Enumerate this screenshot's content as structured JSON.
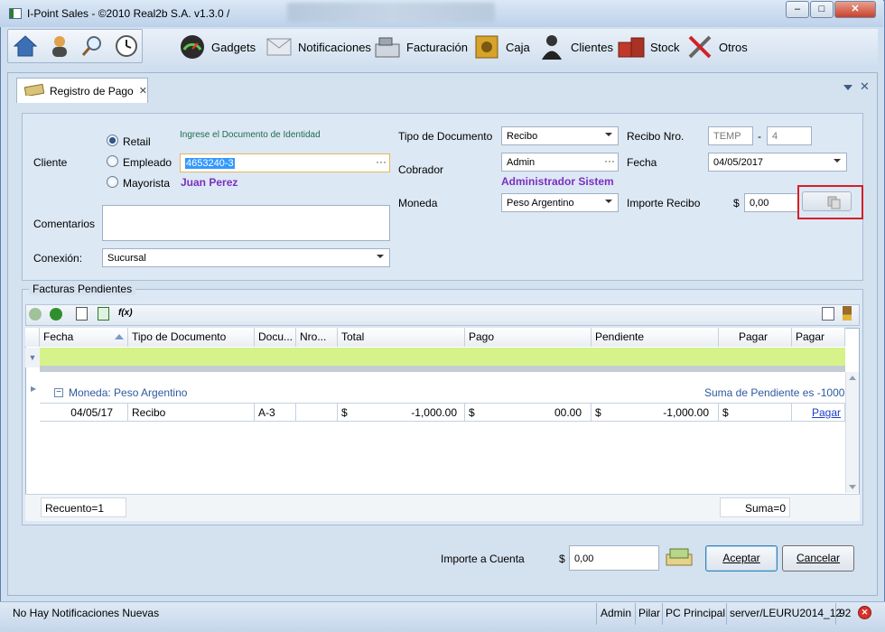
{
  "app": {
    "title": "I-Point Sales  - ©2010 Real2b S.A. v1.3.0 /"
  },
  "window_controls": {
    "minimize": "–",
    "maximize": "□",
    "close": "✕"
  },
  "toolbar": {
    "items": [
      {
        "label": "Gadgets",
        "icon": "gauge-icon"
      },
      {
        "label": "Notificaciones",
        "icon": "envelope-icon"
      },
      {
        "label": "Facturación",
        "icon": "cash-register-icon"
      },
      {
        "label": "Caja",
        "icon": "safe-icon"
      },
      {
        "label": "Clientes",
        "icon": "person-icon"
      },
      {
        "label": "Stock",
        "icon": "boxes-icon"
      },
      {
        "label": "Otros",
        "icon": "tools-icon"
      }
    ]
  },
  "tab": {
    "label": "Registro de Pago",
    "close": "✕"
  },
  "form": {
    "cliente_label": "Cliente",
    "radio": [
      {
        "label": "Retail",
        "checked": true
      },
      {
        "label": "Empleado",
        "checked": false
      },
      {
        "label": "Mayorista",
        "checked": false
      }
    ],
    "doc_hint": "Ingrese el Documento de Identidad",
    "doc_value": "4653240-3",
    "doc_button": "···",
    "client_name": "Juan Perez",
    "comentarios_label": "Comentarios",
    "comentarios_value": "",
    "conexion_label": "Conexión:",
    "conexion_value": "Sucursal",
    "tipo_doc_label": "Tipo de Documento",
    "tipo_doc_value": "Recibo",
    "cobrador_label": "Cobrador",
    "cobrador_value": "Admin",
    "cobrador_button": "···",
    "cobrador_name": "Administrador Sistem",
    "moneda_label": "Moneda",
    "moneda_value": "Peso Argentino",
    "recibo_label": "Recibo Nro.",
    "recibo_prefix": "TEMP",
    "recibo_dash": "-",
    "recibo_num": "4",
    "fecha_label": "Fecha",
    "fecha_value": "04/05/2017",
    "importe_label": "Importe Recibo",
    "importe_currency": "$",
    "importe_value": "0,00"
  },
  "facturas": {
    "title": "Facturas Pendientes",
    "columns": [
      "Fecha",
      "Tipo de Documento",
      "Docu...",
      "Nro...",
      "Total",
      "Pago",
      "Pendiente",
      "Pagar",
      "Pagar"
    ],
    "group_label": "Moneda: Peso Argentino",
    "group_toggle": "−",
    "group_summary": "Suma de Pendiente es -1000",
    "rows": [
      {
        "fecha": "04/05/17",
        "tipo": "Recibo",
        "docu": "A-3",
        "nro": "",
        "total_cur": "$",
        "total": "-1,000.00",
        "pago_cur": "$",
        "pago": "00.00",
        "pend_cur": "$",
        "pend": "-1,000.00",
        "pagar_cur": "$",
        "pagar_link": "Pagar"
      }
    ],
    "recuento": "Recuento=1",
    "suma": "Suma=0"
  },
  "footer": {
    "importe_cuenta_label": "Importe a Cuenta",
    "currency": "$",
    "importe_cuenta_value": "0,00",
    "aceptar": "Aceptar",
    "cancelar": "Cancelar"
  },
  "status": {
    "notifications": "No Hay Notificaciones Nuevas",
    "user": "Admin",
    "branch": "Pilar",
    "pc": "PC Principal",
    "server": "server/LEURU2014_12",
    "num": "92"
  },
  "colors": {
    "purple": "#7b2fbf",
    "link": "#1a3ec9",
    "filter_row": "#d6f28a",
    "accent_red": "#d32027"
  }
}
